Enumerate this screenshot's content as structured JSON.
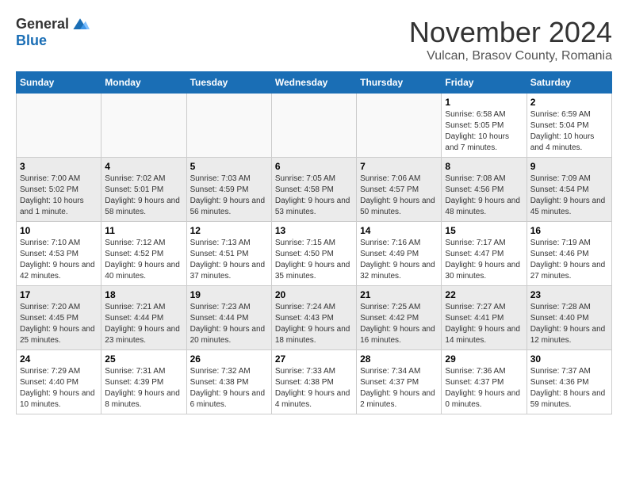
{
  "logo": {
    "general": "General",
    "blue": "Blue"
  },
  "title": "November 2024",
  "subtitle": "Vulcan, Brasov County, Romania",
  "days_of_week": [
    "Sunday",
    "Monday",
    "Tuesday",
    "Wednesday",
    "Thursday",
    "Friday",
    "Saturday"
  ],
  "weeks": [
    [
      {
        "day": "",
        "info": ""
      },
      {
        "day": "",
        "info": ""
      },
      {
        "day": "",
        "info": ""
      },
      {
        "day": "",
        "info": ""
      },
      {
        "day": "",
        "info": ""
      },
      {
        "day": "1",
        "info": "Sunrise: 6:58 AM\nSunset: 5:05 PM\nDaylight: 10 hours and 7 minutes."
      },
      {
        "day": "2",
        "info": "Sunrise: 6:59 AM\nSunset: 5:04 PM\nDaylight: 10 hours and 4 minutes."
      }
    ],
    [
      {
        "day": "3",
        "info": "Sunrise: 7:00 AM\nSunset: 5:02 PM\nDaylight: 10 hours and 1 minute."
      },
      {
        "day": "4",
        "info": "Sunrise: 7:02 AM\nSunset: 5:01 PM\nDaylight: 9 hours and 58 minutes."
      },
      {
        "day": "5",
        "info": "Sunrise: 7:03 AM\nSunset: 4:59 PM\nDaylight: 9 hours and 56 minutes."
      },
      {
        "day": "6",
        "info": "Sunrise: 7:05 AM\nSunset: 4:58 PM\nDaylight: 9 hours and 53 minutes."
      },
      {
        "day": "7",
        "info": "Sunrise: 7:06 AM\nSunset: 4:57 PM\nDaylight: 9 hours and 50 minutes."
      },
      {
        "day": "8",
        "info": "Sunrise: 7:08 AM\nSunset: 4:56 PM\nDaylight: 9 hours and 48 minutes."
      },
      {
        "day": "9",
        "info": "Sunrise: 7:09 AM\nSunset: 4:54 PM\nDaylight: 9 hours and 45 minutes."
      }
    ],
    [
      {
        "day": "10",
        "info": "Sunrise: 7:10 AM\nSunset: 4:53 PM\nDaylight: 9 hours and 42 minutes."
      },
      {
        "day": "11",
        "info": "Sunrise: 7:12 AM\nSunset: 4:52 PM\nDaylight: 9 hours and 40 minutes."
      },
      {
        "day": "12",
        "info": "Sunrise: 7:13 AM\nSunset: 4:51 PM\nDaylight: 9 hours and 37 minutes."
      },
      {
        "day": "13",
        "info": "Sunrise: 7:15 AM\nSunset: 4:50 PM\nDaylight: 9 hours and 35 minutes."
      },
      {
        "day": "14",
        "info": "Sunrise: 7:16 AM\nSunset: 4:49 PM\nDaylight: 9 hours and 32 minutes."
      },
      {
        "day": "15",
        "info": "Sunrise: 7:17 AM\nSunset: 4:47 PM\nDaylight: 9 hours and 30 minutes."
      },
      {
        "day": "16",
        "info": "Sunrise: 7:19 AM\nSunset: 4:46 PM\nDaylight: 9 hours and 27 minutes."
      }
    ],
    [
      {
        "day": "17",
        "info": "Sunrise: 7:20 AM\nSunset: 4:45 PM\nDaylight: 9 hours and 25 minutes."
      },
      {
        "day": "18",
        "info": "Sunrise: 7:21 AM\nSunset: 4:44 PM\nDaylight: 9 hours and 23 minutes."
      },
      {
        "day": "19",
        "info": "Sunrise: 7:23 AM\nSunset: 4:44 PM\nDaylight: 9 hours and 20 minutes."
      },
      {
        "day": "20",
        "info": "Sunrise: 7:24 AM\nSunset: 4:43 PM\nDaylight: 9 hours and 18 minutes."
      },
      {
        "day": "21",
        "info": "Sunrise: 7:25 AM\nSunset: 4:42 PM\nDaylight: 9 hours and 16 minutes."
      },
      {
        "day": "22",
        "info": "Sunrise: 7:27 AM\nSunset: 4:41 PM\nDaylight: 9 hours and 14 minutes."
      },
      {
        "day": "23",
        "info": "Sunrise: 7:28 AM\nSunset: 4:40 PM\nDaylight: 9 hours and 12 minutes."
      }
    ],
    [
      {
        "day": "24",
        "info": "Sunrise: 7:29 AM\nSunset: 4:40 PM\nDaylight: 9 hours and 10 minutes."
      },
      {
        "day": "25",
        "info": "Sunrise: 7:31 AM\nSunset: 4:39 PM\nDaylight: 9 hours and 8 minutes."
      },
      {
        "day": "26",
        "info": "Sunrise: 7:32 AM\nSunset: 4:38 PM\nDaylight: 9 hours and 6 minutes."
      },
      {
        "day": "27",
        "info": "Sunrise: 7:33 AM\nSunset: 4:38 PM\nDaylight: 9 hours and 4 minutes."
      },
      {
        "day": "28",
        "info": "Sunrise: 7:34 AM\nSunset: 4:37 PM\nDaylight: 9 hours and 2 minutes."
      },
      {
        "day": "29",
        "info": "Sunrise: 7:36 AM\nSunset: 4:37 PM\nDaylight: 9 hours and 0 minutes."
      },
      {
        "day": "30",
        "info": "Sunrise: 7:37 AM\nSunset: 4:36 PM\nDaylight: 8 hours and 59 minutes."
      }
    ]
  ]
}
